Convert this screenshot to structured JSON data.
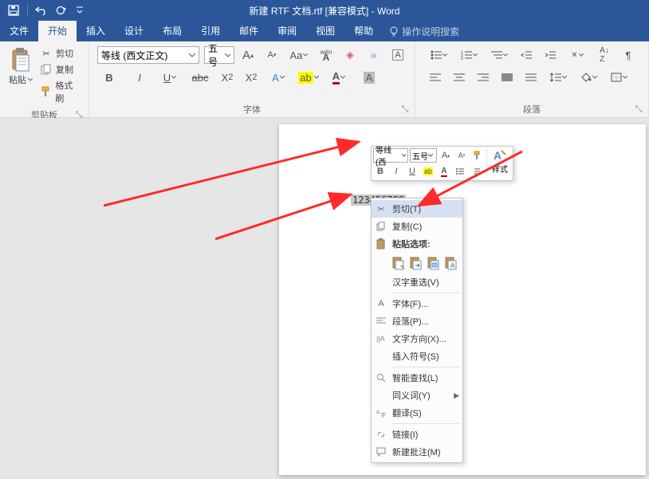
{
  "title": "新建 RTF 文档.rtf [兼容模式] - Word",
  "menu": {
    "file": "文件",
    "home": "开始",
    "insert": "插入",
    "design": "设计",
    "layout": "布局",
    "references": "引用",
    "mail": "邮件",
    "review": "审阅",
    "view": "视图",
    "help": "帮助",
    "tellme": "操作说明搜索"
  },
  "clipboard": {
    "paste": "粘贴",
    "cut": "剪切",
    "copy": "复制",
    "format_painter": "格式刷",
    "group": "剪贴板"
  },
  "font": {
    "name": "等线 (西文正文)",
    "size": "五号",
    "group": "字体"
  },
  "paragraph": {
    "group": "段落"
  },
  "doc": {
    "selected_text": "123456789"
  },
  "mini": {
    "font": "等线 (西",
    "size": "五号",
    "styles": "样式"
  },
  "context": {
    "cut": "剪切(T)",
    "copy": "复制(C)",
    "paste_options": "粘贴选项:",
    "cn_relayout": "汉字重选(V)",
    "font": "字体(F)...",
    "paragraph": "段落(P)...",
    "text_direction": "文字方向(X)...",
    "insert_symbol": "插入符号(S)",
    "smart_lookup": "智能查找(L)",
    "synonyms": "同义词(Y)",
    "translate": "翻译(S)",
    "link": "链接(I)",
    "new_comment": "新建批注(M)"
  }
}
